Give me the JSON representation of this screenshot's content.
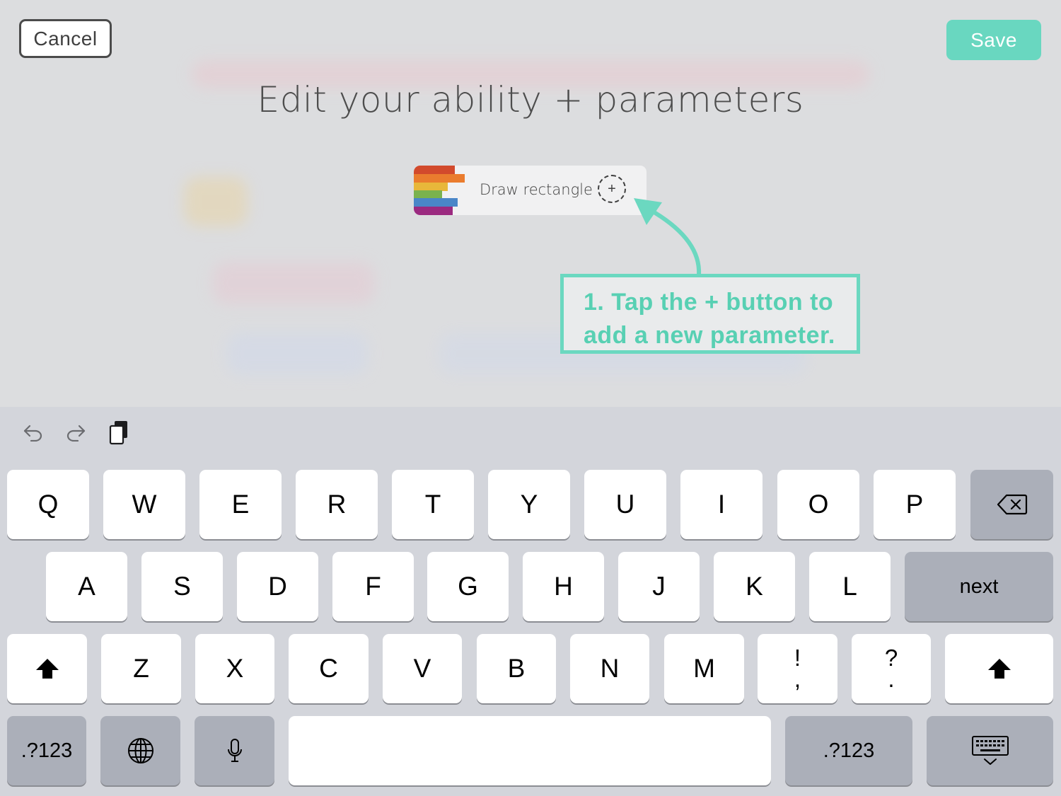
{
  "header": {
    "cancel_label": "Cancel",
    "save_label": "Save",
    "title": "Edit your ability + parameters"
  },
  "block": {
    "label": "Draw rectangle",
    "add_symbol": "+",
    "stripe_colors": [
      "#d24a2c",
      "#ea7c2e",
      "#e8b73a",
      "#7ab24e",
      "#4a86c8",
      "#9b2a80"
    ]
  },
  "tip": {
    "line1": "1. Tap the + button to",
    "line2": "add a new parameter."
  },
  "colors": {
    "accent": "#69d7c0",
    "tip_text": "#58d0b3"
  },
  "keyboard": {
    "toolbar": [
      "undo-icon",
      "redo-icon",
      "clipboard-icon"
    ],
    "row1": [
      "Q",
      "W",
      "E",
      "R",
      "T",
      "Y",
      "U",
      "I",
      "O",
      "P"
    ],
    "row2": [
      "A",
      "S",
      "D",
      "F",
      "G",
      "H",
      "J",
      "K",
      "L"
    ],
    "row2_action": "next",
    "row3": [
      "Z",
      "X",
      "C",
      "V",
      "B",
      "N",
      "M"
    ],
    "punct1_top": "!",
    "punct1_bottom": ",",
    "punct2_top": "?",
    "punct2_bottom": ".",
    "numbers_label": ".?123"
  }
}
